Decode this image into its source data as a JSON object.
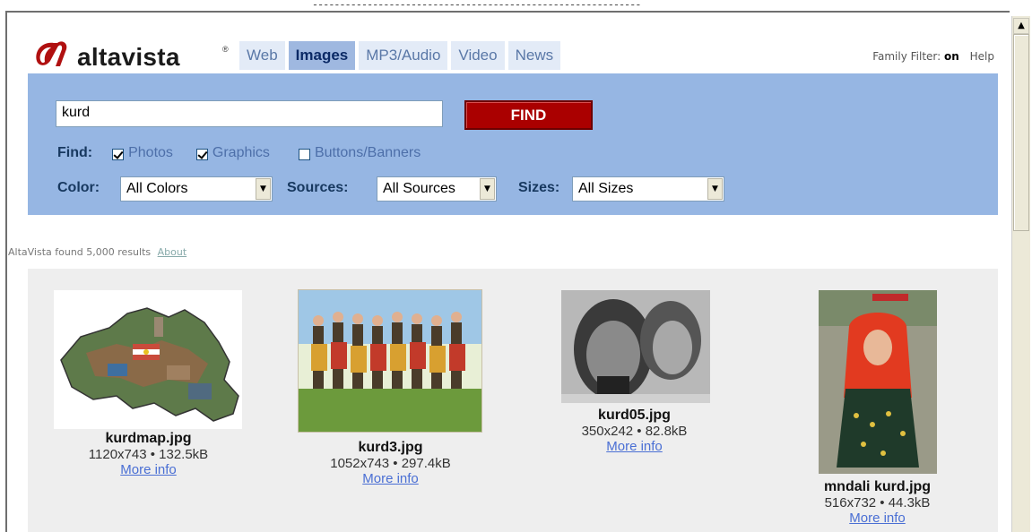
{
  "logo": {
    "text": "altavista",
    "trademark": "®"
  },
  "tabs": [
    {
      "label": "Web",
      "active": false
    },
    {
      "label": "Images",
      "active": true
    },
    {
      "label": "MP3/Audio",
      "active": false
    },
    {
      "label": "Video",
      "active": false
    },
    {
      "label": "News",
      "active": false
    }
  ],
  "header": {
    "family_filter_label": "Family Filter:",
    "family_filter_value": "on",
    "help": "Help"
  },
  "search": {
    "query": "kurd",
    "find_button": "FIND",
    "find_label": "Find:",
    "options": [
      {
        "label": "Photos",
        "checked": true
      },
      {
        "label": "Graphics",
        "checked": true
      },
      {
        "label": "Buttons/Banners",
        "checked": false
      }
    ],
    "color_label": "Color:",
    "color_value": "All Colors",
    "sources_label": "Sources:",
    "sources_value": "All Sources",
    "sizes_label": "Sizes:",
    "sizes_value": "All Sizes"
  },
  "results": {
    "text": "AltaVista found 5,000 results",
    "about": "About"
  },
  "images": [
    {
      "filename": "kurdmap.jpg",
      "meta": "1120x743 • 132.5kB",
      "more": "More info"
    },
    {
      "filename": "kurd3.jpg",
      "meta": "1052x743 • 297.4kB",
      "more": "More info"
    },
    {
      "filename": "kurd05.jpg",
      "meta": "350x242 • 82.8kB",
      "more": "More info"
    },
    {
      "filename": "mndali kurd.jpg",
      "meta": "516x732 • 44.3kB",
      "more": "More info"
    }
  ],
  "colors": {
    "search_bg": "#96b6e3",
    "find_red": "#aa0000",
    "link_blue": "#4a6fd4",
    "gallery_bg": "#eeeeee"
  }
}
